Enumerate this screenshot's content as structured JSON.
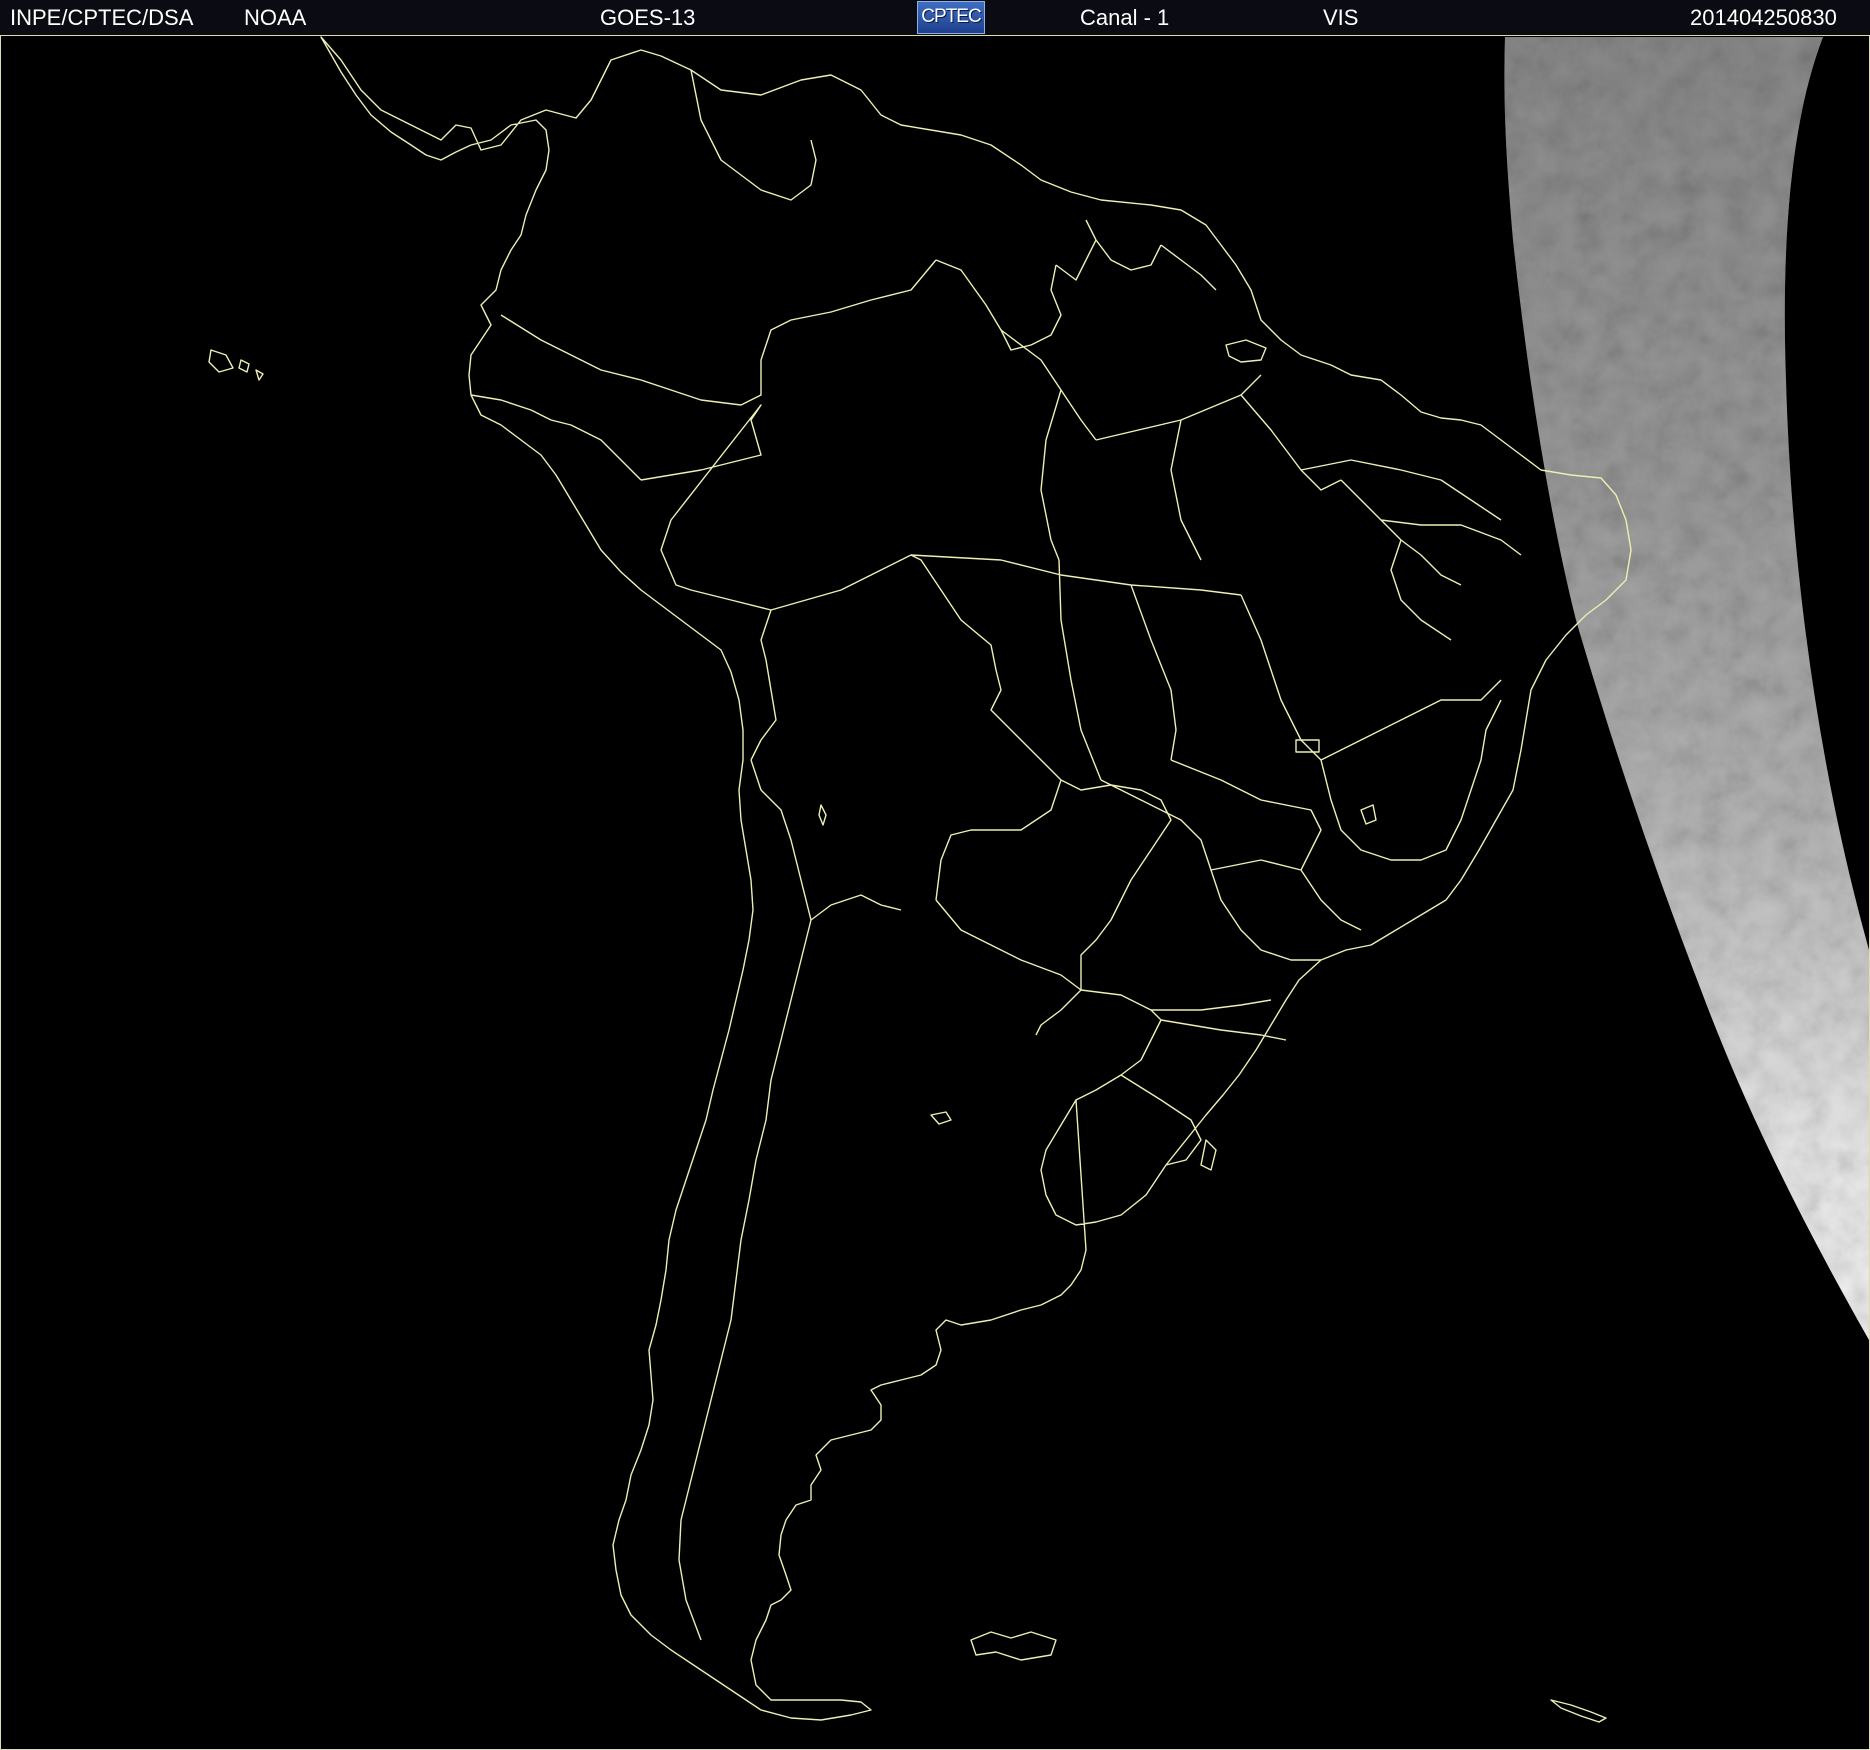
{
  "header": {
    "institution": "INPE/CPTEC/DSA",
    "agency": "NOAA",
    "satellite": "GOES-13",
    "logo_text": "CPTEC",
    "channel": "Canal - 1",
    "band": "VIS",
    "timestamp": "201404250830"
  },
  "colors": {
    "background": "#000000",
    "border_lines": "#eeeeb4",
    "header_background": "#0b0b14",
    "header_text": "#ffffff",
    "logo_background": "#2b57aa",
    "cloud_imagery": "#9a9a9a"
  },
  "map": {
    "projection_extent": "South America",
    "imagery_visible": "sunlit region on the east edge (Atlantic)"
  }
}
